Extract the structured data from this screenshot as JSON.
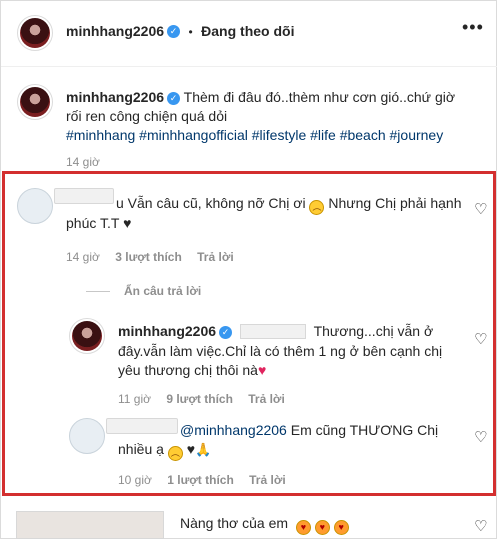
{
  "header": {
    "username": "minhhang2206",
    "separator": "•",
    "follow_status": "Đang theo dõi",
    "more_icon": "more-horizontal-icon"
  },
  "caption": {
    "username": "minhhang2206",
    "text": "Thèm đi đâu đó..thèm như cơn gió..chứ giờ rối ren công chiện quá dỏi",
    "hashtags": "#minhhang #minhhangofficial #lifestyle #life #beach #journey",
    "time": "14 giờ"
  },
  "comments": [
    {
      "text_suffix": "u Vẫn câu cũ, không nỡ Chị ơi",
      "text_suffix2": "Nhưng Chị phải hạnh",
      "text_line2": "phúc T.T",
      "emoji_sad": "sad-face-emoji",
      "emoji_heart": "♥",
      "time": "14 giờ",
      "likes": "3 lượt thích",
      "reply": "Trả lời"
    }
  ],
  "hide_replies": "Ẩn câu trả lời",
  "reply1": {
    "username": "minhhang2206",
    "text_line1": "Thương...chị vẫn ở",
    "text_line2": "đây.vẫn làm việc.Chỉ là có thêm 1 ng ở bên cạnh chị",
    "text_line3": "yêu thương chị thôi nà",
    "heart": "♥",
    "time": "11 giờ",
    "likes": "9 lượt thích",
    "reply": "Trả lời"
  },
  "reply2": {
    "mention": "@minhhang2206",
    "text_line1": "Em cũng THƯƠNG Chị",
    "text_line2": "nhiều ạ",
    "emoji_heart": "♥",
    "emoji_pray": "🙏",
    "time": "10 giờ",
    "likes": "1 lượt thích",
    "reply": "Trả lời"
  },
  "last_comment": {
    "text": "Nàng thơ của em"
  },
  "colors": {
    "highlight_border": "#d32f2f",
    "verified": "#3897f0",
    "link": "#00376b",
    "meta": "#8e8e8e"
  }
}
